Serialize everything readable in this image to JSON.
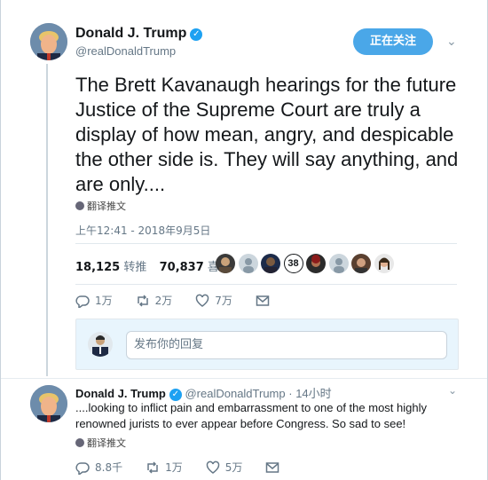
{
  "tweet": {
    "author_name": "Donald J. Trump",
    "author_handle": "@realDonaldTrump",
    "follow_label": "正在关注",
    "text": "The Brett Kavanaugh hearings for the future Justice of the Supreme Court are truly a display of how mean, angry, and despicable the other side is. They will say anything, and are only....",
    "translate_label": "翻译推文",
    "timestamp": "上午12:41 - 2018年9月5日",
    "retweets_count": "18,125",
    "retweets_label": "转推",
    "likes_count": "70,837",
    "likes_label": "喜欢",
    "likers_more": "38",
    "reply_count": "1万",
    "retweet_count_short": "2万",
    "like_count_short": "7万"
  },
  "reply_box": {
    "placeholder": "发布你的回复"
  },
  "reply_tweet": {
    "author_name": "Donald J. Trump",
    "author_handle": "@realDonaldTrump",
    "time": "· 14小时",
    "text": "....looking to inflict pain and embarrassment to one of the most highly renowned jurists to ever appear before Congress. So sad to see!",
    "translate_label": "翻译推文",
    "reply_count": "8.8千",
    "retweet_count": "1万",
    "like_count": "5万"
  },
  "colors": {
    "accent": "#1da1f2",
    "follow_button": "#4aa7e8",
    "secondary_text": "#657786"
  }
}
